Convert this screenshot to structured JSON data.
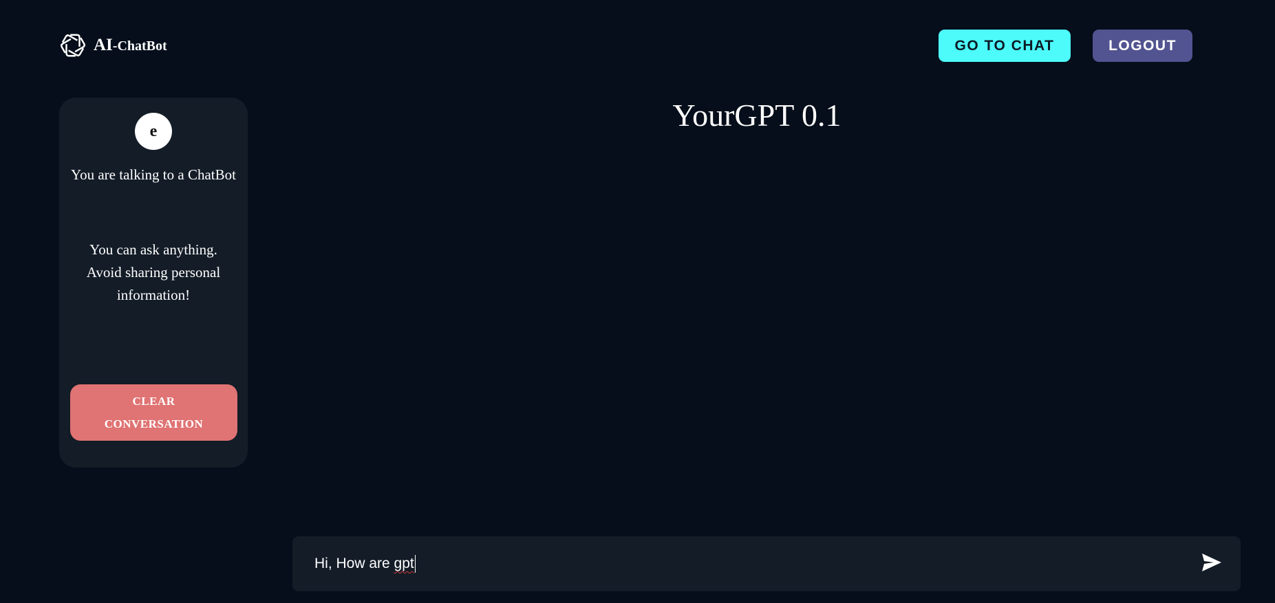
{
  "header": {
    "brand_main": "AI",
    "brand_sub": "-ChatBot",
    "logo_icon": "openai-knot-icon",
    "go_to_chat_label": "GO TO CHAT",
    "logout_label": "LOGOUT"
  },
  "sidebar": {
    "avatar_letter": "e",
    "talking_text": "You are talking to a ChatBot",
    "notice_text": "You can ask anything. Avoid sharing personal information!",
    "clear_button_label": "CLEAR CONVERSATION"
  },
  "main": {
    "title": "YourGPT 0.1"
  },
  "composer": {
    "input_value_start": "Hi, How are ",
    "input_value_misspelled": "gpt",
    "send_icon": "send-icon"
  },
  "colors": {
    "background": "#050e1a",
    "card": "#131c27",
    "go_to_chat": "#4dfbfb",
    "logout": "#525491",
    "clear": "#e07373"
  }
}
